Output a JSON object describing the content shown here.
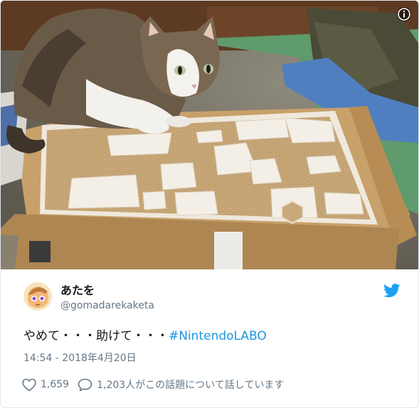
{
  "tweet": {
    "author_name": "あたを",
    "author_handle": "@gomadarekaketa",
    "text_prefix": "やめて・・・助けて・・・",
    "hashtag": "#NintendoLABO",
    "timestamp": "14:54 - 2018年4月20日",
    "like_count": "1,659",
    "talking_text": "1,203人がこの話題について話しています"
  },
  "icons": {
    "info": "info-icon",
    "bird": "twitter-bird-icon",
    "heart": "heart-icon",
    "reply": "speech-bubble-icon"
  },
  "colors": {
    "link": "#1b95e0",
    "twitter_blue": "#1da1f2",
    "secondary_text": "#657786"
  }
}
